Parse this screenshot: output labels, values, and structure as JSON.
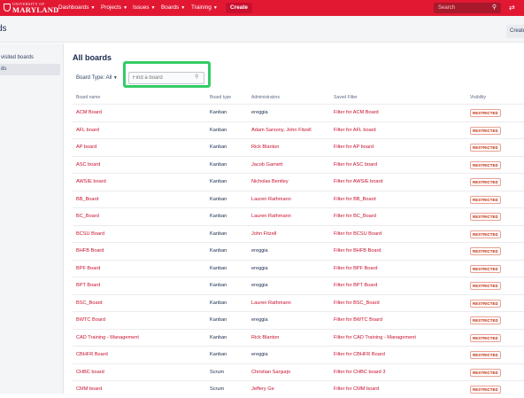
{
  "header": {
    "logo_line1": "UNIVERSITY OF",
    "logo_line2": "MARYLAND",
    "nav": [
      {
        "label": "Dashboards"
      },
      {
        "label": "Projects"
      },
      {
        "label": "Issues"
      },
      {
        "label": "Boards"
      },
      {
        "label": "Training"
      }
    ],
    "create_label": "Create",
    "search_placeholder": "Search",
    "brand_color": "#e21833"
  },
  "subheader": {
    "title_fragment": "ds",
    "create_board_label": "Create"
  },
  "sidebar": {
    "items": [
      {
        "label": "visited boards",
        "active": false
      },
      {
        "label": "ds",
        "active": true
      }
    ]
  },
  "main": {
    "title": "All boards",
    "board_type_label": "Board Type: All",
    "find_placeholder": "Find a board",
    "columns": [
      "Board name",
      "Board type",
      "Administrators",
      "Saved Filter",
      "Visibility"
    ],
    "rows": [
      {
        "name": "ACM Board",
        "type": "Kanban",
        "admin": "ereggia",
        "admin_link": false,
        "filter": "Filter for ACM Board",
        "visibility": "RESTRICTED"
      },
      {
        "name": "AFL board",
        "type": "Kanban",
        "admin": "Adam Sarsony, John Fitzell",
        "admin_link": true,
        "filter": "Filter for AFL board",
        "visibility": "RESTRICTED"
      },
      {
        "name": "AP board",
        "type": "Kanban",
        "admin": "Rick Blanton",
        "admin_link": true,
        "filter": "Filter for AP board",
        "visibility": "RESTRICTED"
      },
      {
        "name": "ASC board",
        "type": "Kanban",
        "admin": "Jacob Garnett",
        "admin_link": true,
        "filter": "Filter for ASC board",
        "visibility": "RESTRICTED"
      },
      {
        "name": "AWSIE board",
        "type": "Kanban",
        "admin": "Nicholas Bentley",
        "admin_link": true,
        "filter": "Filter for AWSIE board",
        "visibility": "RESTRICTED"
      },
      {
        "name": "BB_Board",
        "type": "Kanban",
        "admin": "Lauren Rathmann",
        "admin_link": true,
        "filter": "Filter for BB_Board",
        "visibility": "RESTRICTED"
      },
      {
        "name": "BC_Board",
        "type": "Kanban",
        "admin": "Lauren Rathmann",
        "admin_link": true,
        "filter": "Filter for BC_Board",
        "visibility": "RESTRICTED"
      },
      {
        "name": "BCSU Board",
        "type": "Kanban",
        "admin": "John Fitzell",
        "admin_link": true,
        "filter": "Filter for BCSU Board",
        "visibility": "RESTRICTED"
      },
      {
        "name": "BHFB Board",
        "type": "Kanban",
        "admin": "ereggia",
        "admin_link": false,
        "filter": "Filter for BHFB Board",
        "visibility": "RESTRICTED"
      },
      {
        "name": "BPF Board",
        "type": "Kanban",
        "admin": "ereggia",
        "admin_link": false,
        "filter": "Filter for BPF Board",
        "visibility": "RESTRICTED"
      },
      {
        "name": "BPT Board",
        "type": "Kanban",
        "admin": "ereggia",
        "admin_link": false,
        "filter": "Filter for BPT Board",
        "visibility": "RESTRICTED"
      },
      {
        "name": "BSC_Board",
        "type": "Kanban",
        "admin": "Lauren Rathmann",
        "admin_link": true,
        "filter": "Filter for BSC_Board",
        "visibility": "RESTRICTED"
      },
      {
        "name": "BWTC Board",
        "type": "Kanban",
        "admin": "ereggia",
        "admin_link": false,
        "filter": "Filter for BWTC Board",
        "visibility": "RESTRICTED"
      },
      {
        "name": "CAD Training - Management",
        "type": "Kanban",
        "admin": "Rick Blanton",
        "admin_link": true,
        "filter": "Filter for CAD Training - Management",
        "visibility": "RESTRICTED"
      },
      {
        "name": "CBHFR Board",
        "type": "Kanban",
        "admin": "ereggia",
        "admin_link": false,
        "filter": "Filter for CBHFR Board",
        "visibility": "RESTRICTED"
      },
      {
        "name": "CHBC board",
        "type": "Scrum",
        "admin": "Christian Sanjurjo",
        "admin_link": true,
        "filter": "Filter for CHBC board 3",
        "visibility": "RESTRICTED"
      },
      {
        "name": "CMM board",
        "type": "Scrum",
        "admin": "Jeffery Ge",
        "admin_link": true,
        "filter": "Filter for CMM board",
        "visibility": "RESTRICTED"
      }
    ]
  }
}
